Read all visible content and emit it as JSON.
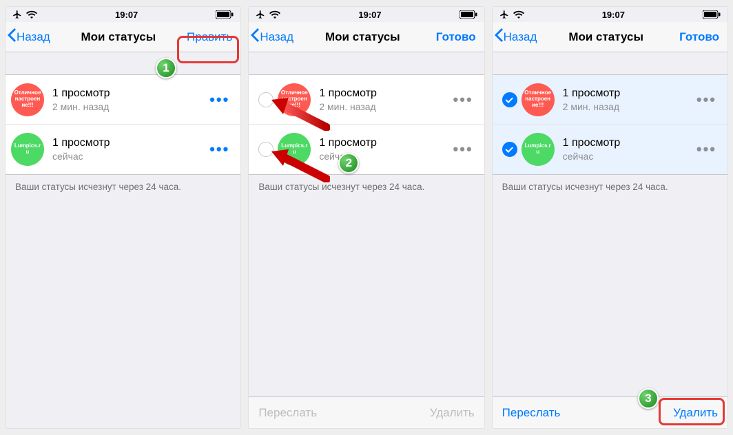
{
  "statusbar": {
    "time": "19:07"
  },
  "nav": {
    "back": "Назад",
    "title": "Мои статусы",
    "edit": "Править",
    "done": "Готово"
  },
  "rows": [
    {
      "avatarText": "Отличное настроение!!!",
      "title": "1 просмотр",
      "sub": "2 мин. назад"
    },
    {
      "avatarText": "Lumpics.ru",
      "title": "1 просмотр",
      "sub": "сейчас"
    }
  ],
  "footer": "Ваши статусы исчезнут через 24 часа.",
  "toolbar": {
    "forward": "Переслать",
    "delete": "Удалить"
  },
  "steps": {
    "s1": "1",
    "s2": "2",
    "s3": "3"
  }
}
